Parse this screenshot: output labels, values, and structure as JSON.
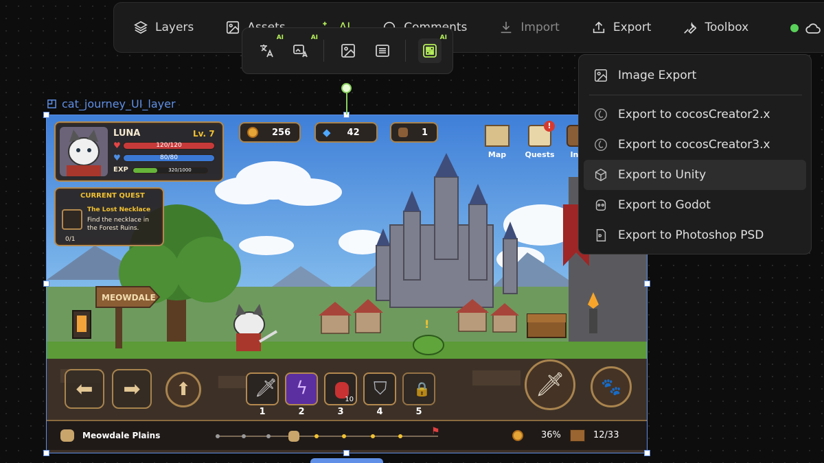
{
  "toolbar": {
    "layers": "Layers",
    "assets": "Assets",
    "ai": "AI",
    "comments": "Comments",
    "import": "Import",
    "export": "Export",
    "toolbox": "Toolbox",
    "ai_tag": "AI",
    "status_color": "#59d15a"
  },
  "subbar": {
    "ai_tag": "AI",
    "buttons": [
      "translate-icon",
      "image-translate-icon",
      "image-icon",
      "text-lines-icon",
      "grid-icon"
    ]
  },
  "export_menu": {
    "items": [
      {
        "label": "Image Export",
        "icon": "image-icon"
      },
      {
        "label": "Export to cocosCreator2.x",
        "icon": "cocos-icon"
      },
      {
        "label": "Export to cocosCreator3.x",
        "icon": "cocos-icon"
      },
      {
        "label": "Export to Unity",
        "icon": "unity-icon"
      },
      {
        "label": "Export to Godot",
        "icon": "godot-icon"
      },
      {
        "label": "Export to Photoshop PSD",
        "icon": "psd-icon"
      }
    ]
  },
  "layer": {
    "name": "cat_journey_UI_layer"
  },
  "game": {
    "player": {
      "name": "LUNA",
      "level": "Lv. 7",
      "hp": "120/120",
      "mp": "80/80",
      "exp_label": "EXP",
      "exp": "320/1000",
      "hp_fraction": 1.0,
      "mp_fraction": 1.0,
      "exp_fraction": 0.32
    },
    "resources": {
      "coins": "256",
      "gems": "42",
      "bags": "1"
    },
    "menu": {
      "map": "Map",
      "quests": "Quests",
      "inventory": "Inv"
    },
    "quest": {
      "header": "CURRENT QUEST",
      "title": "The Lost Necklace",
      "desc": "Find the necklace in the Forest Ruins.",
      "progress": "0/1"
    },
    "signpost": "MEOWDALE",
    "hotbar": [
      "1",
      "2",
      "3",
      "4",
      "5"
    ],
    "potion_count": "10",
    "footer": {
      "location": "Meowdale Plains",
      "percent": "36%",
      "chests": "12/33"
    }
  },
  "colors": {
    "accent": "#5f8fe6",
    "ai_green": "#b6ef5b",
    "panel_border": "#b3894f"
  }
}
